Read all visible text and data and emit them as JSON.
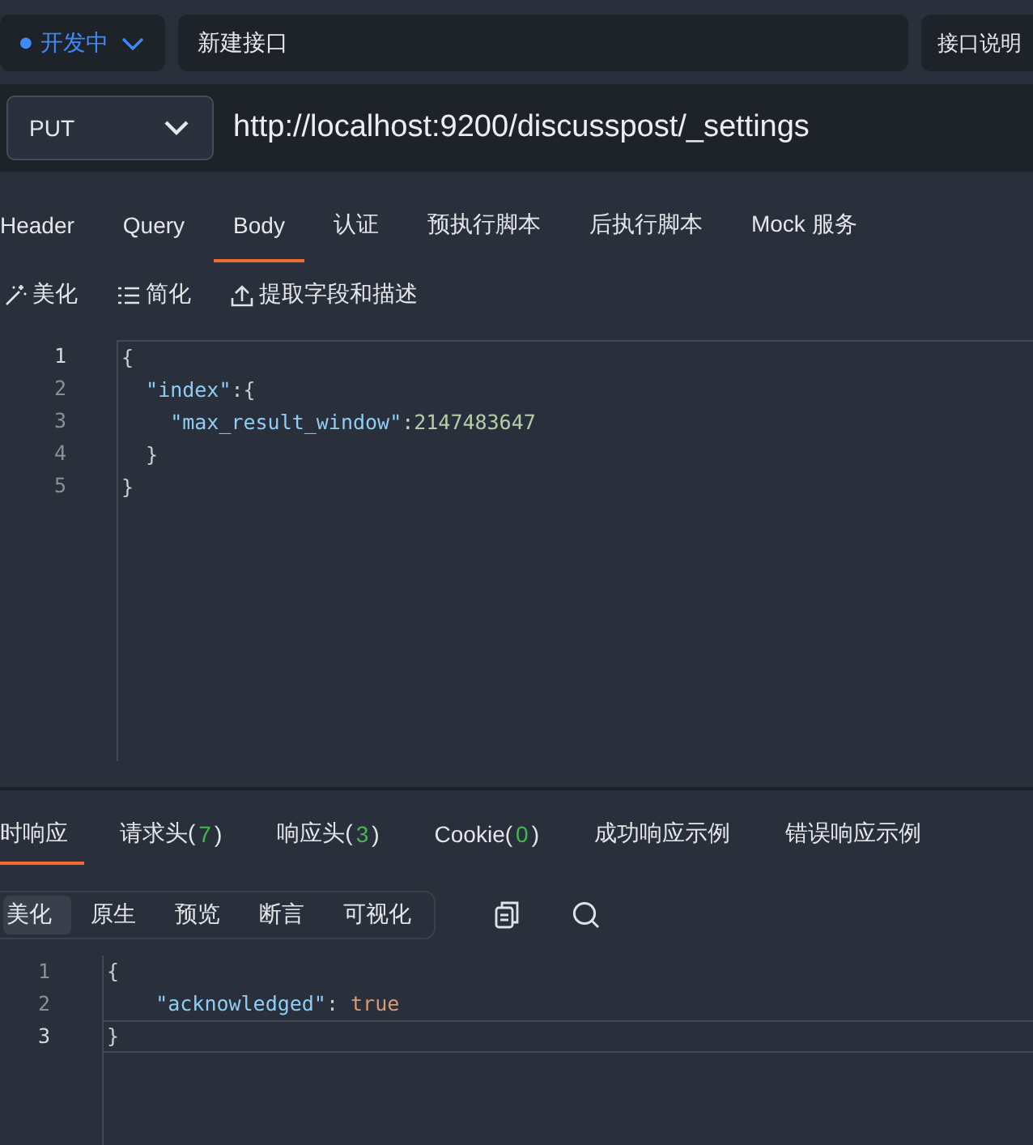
{
  "status": {
    "dot": "●",
    "label": "开发中",
    "color": "#3d8bfd"
  },
  "name_field": {
    "value": "新建接口"
  },
  "desc_button": {
    "label": "接口说明"
  },
  "method": {
    "value": "PUT"
  },
  "url": {
    "value": "http://localhost:9200/discusspost/_settings"
  },
  "request_tabs": [
    {
      "label": "Header",
      "selected": false
    },
    {
      "label": "Query",
      "selected": false
    },
    {
      "label": "Body",
      "selected": true
    },
    {
      "label": "认证",
      "selected": false
    },
    {
      "label": "预执行脚本",
      "selected": false
    },
    {
      "label": "后执行脚本",
      "selected": false
    },
    {
      "label": "Mock 服务",
      "selected": false
    }
  ],
  "body_tools": [
    {
      "label": "美化",
      "kind": "wand"
    },
    {
      "label": "简化",
      "kind": "list"
    },
    {
      "label": "提取字段和描述",
      "kind": "upload"
    }
  ],
  "body_editor": {
    "lines": [
      {
        "number": "1",
        "active": true,
        "tokens": [
          {
            "text": "{",
            "kind": "punct"
          }
        ]
      },
      {
        "number": "2",
        "active": false,
        "tokens": [
          {
            "text": "  \"index\"",
            "kind": "key"
          },
          {
            "text": ":{",
            "kind": "punct"
          }
        ]
      },
      {
        "number": "3",
        "active": false,
        "tokens": [
          {
            "text": "    \"max_result_window\"",
            "kind": "key"
          },
          {
            "text": ":",
            "kind": "punct"
          },
          {
            "text": "2147483647",
            "kind": "number"
          }
        ]
      },
      {
        "number": "4",
        "active": false,
        "tokens": [
          {
            "text": "  }",
            "kind": "punct"
          }
        ]
      },
      {
        "number": "5",
        "active": false,
        "tokens": [
          {
            "text": "}",
            "kind": "punct"
          }
        ]
      }
    ]
  },
  "response_tabs": [
    {
      "label": "时响应",
      "selected": true
    },
    {
      "label": "请求头(",
      "count": "7",
      "close": ")",
      "selected": false
    },
    {
      "label": "响应头(",
      "count": "3",
      "close": ")",
      "selected": false
    },
    {
      "label": "Cookie(",
      "count": "0",
      "close": ")",
      "selected": false
    },
    {
      "label": "成功响应示例",
      "selected": false
    },
    {
      "label": "错误响应示例",
      "selected": false
    }
  ],
  "view_modes": [
    {
      "label": "美化",
      "selected": true
    },
    {
      "label": "原生",
      "selected": false
    },
    {
      "label": "预览",
      "selected": false
    },
    {
      "label": "断言",
      "selected": false
    },
    {
      "label": "可视化",
      "selected": false
    }
  ],
  "response_editor": {
    "lines": [
      {
        "number": "1",
        "active": false,
        "tokens": [
          {
            "text": "{",
            "kind": "punct"
          }
        ]
      },
      {
        "number": "2",
        "active": false,
        "tokens": [
          {
            "text": "    \"acknowledged\"",
            "kind": "key"
          },
          {
            "text": ": ",
            "kind": "punct"
          },
          {
            "text": "true",
            "kind": "bool"
          }
        ]
      },
      {
        "number": "3",
        "active": true,
        "tokens": [
          {
            "text": "}",
            "kind": "punct"
          }
        ]
      }
    ]
  }
}
